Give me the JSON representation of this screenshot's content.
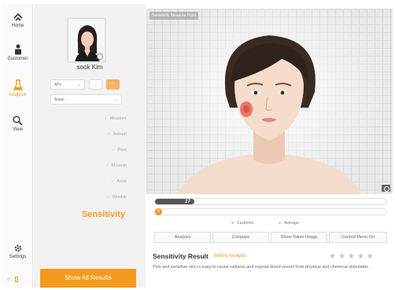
{
  "nav": {
    "items": [
      {
        "label": "Home",
        "icon": "home-icon"
      },
      {
        "label": "Customer",
        "icon": "customer-icon"
      },
      {
        "label": "Analysis",
        "icon": "analysis-icon",
        "active": true
      },
      {
        "label": "View",
        "icon": "view-icon"
      }
    ],
    "settings_label": "Settings"
  },
  "customer": {
    "name": "sook Kim",
    "age_value": "40's",
    "ethnicity_value": "Asian"
  },
  "metrics": [
    "Moisture",
    "Sebum",
    "Pore",
    "Melanin",
    "Acne",
    "Wrinkle"
  ],
  "active_metric": "Sensitivity",
  "show_all_label": "Show All Results",
  "stage": {
    "tag": "Sensitivity Measure Point"
  },
  "scores": {
    "customer_value": "17",
    "customer_fraction": 0.17,
    "average_value": "0"
  },
  "legend": {
    "customer": "Customer",
    "average": "Average"
  },
  "tabs": [
    "Analysis",
    "Compare",
    "Show Taken Image",
    "Control Menu On"
  ],
  "result": {
    "title": "Sensitivity Result",
    "subtitle": "Before Analysis",
    "stars": "★★★★★",
    "description": "Thin and sensitive skin is easy to cause redness and expose blood vessel from physical and chemical stimulates."
  },
  "colors": {
    "accent": "#f39a1f",
    "panel": "#f2f2f2",
    "bar_fill": "#555555"
  }
}
